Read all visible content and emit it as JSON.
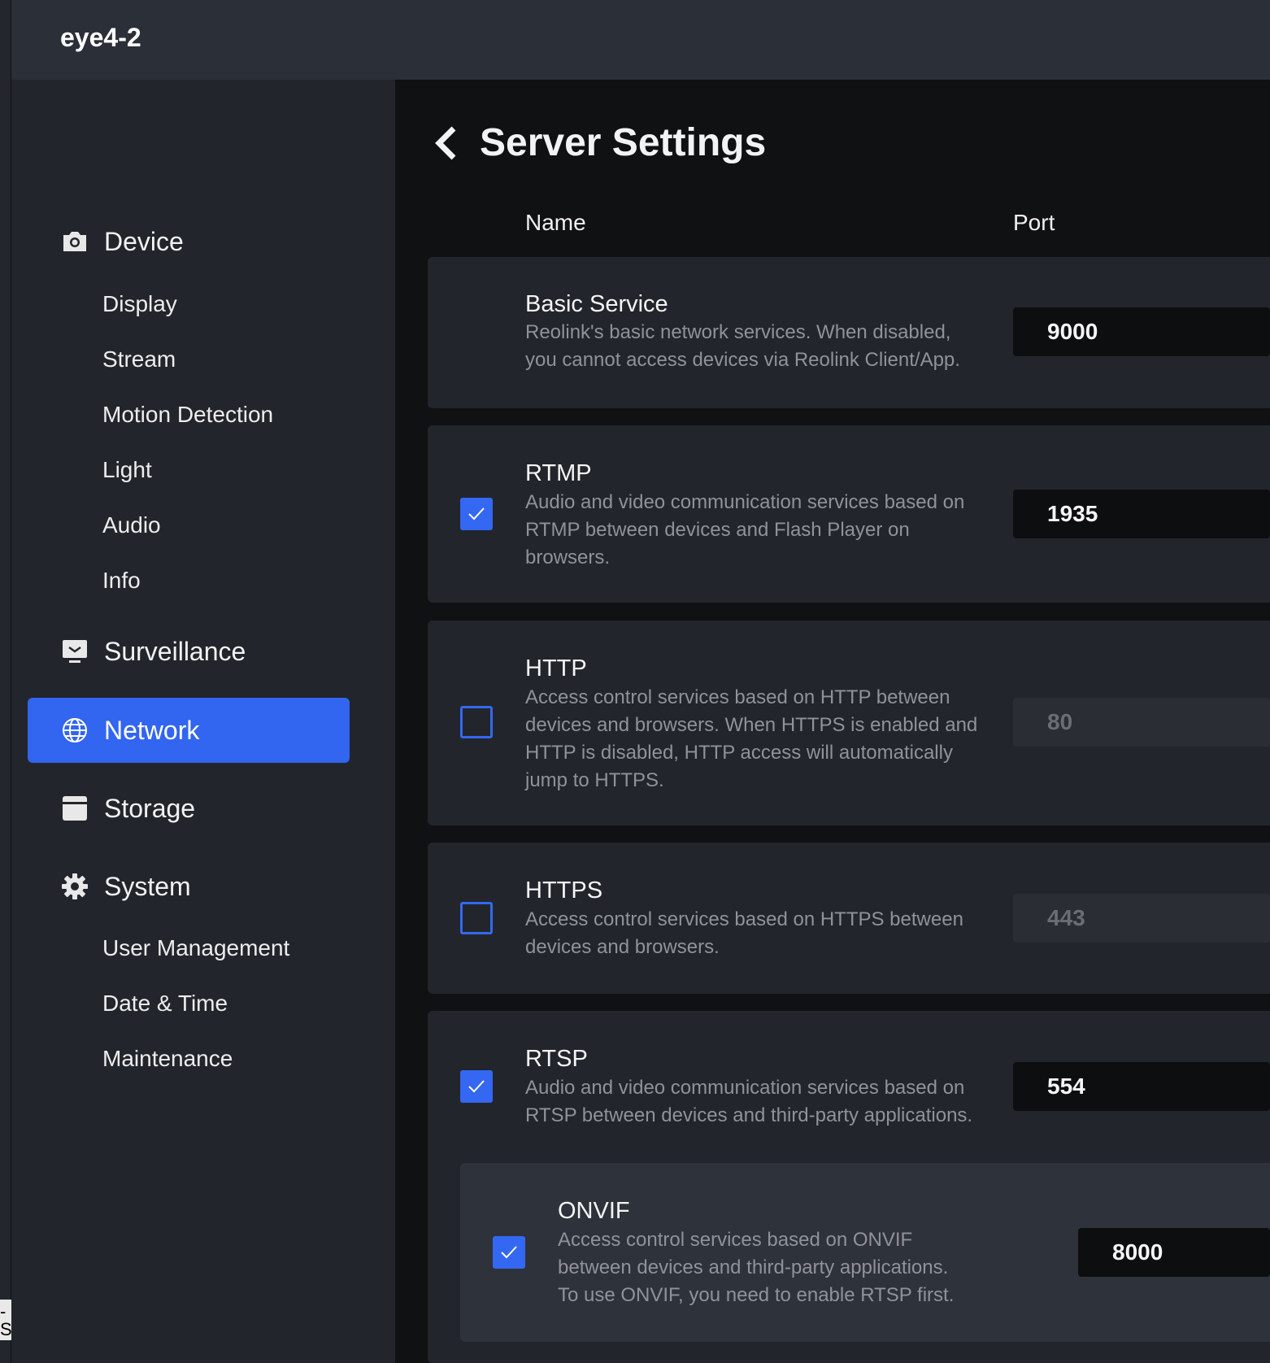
{
  "app_title": "eye4-2",
  "edge_text": "-S",
  "sidebar": {
    "sections": [
      {
        "label": "Device",
        "icon": "camera-icon"
      },
      {
        "label": "Surveillance",
        "icon": "monitor-icon"
      },
      {
        "label": "Network",
        "icon": "globe-icon"
      },
      {
        "label": "Storage",
        "icon": "storage-icon"
      },
      {
        "label": "System",
        "icon": "gear-icon"
      }
    ],
    "device_items": [
      "Display",
      "Stream",
      "Motion Detection",
      "Light",
      "Audio",
      "Info"
    ],
    "system_items": [
      "User Management",
      "Date & Time",
      "Maintenance"
    ],
    "active_section": "Network",
    "accent_color": "#3265f0"
  },
  "main": {
    "title": "Server Settings",
    "columns": {
      "name": "Name",
      "port": "Port"
    },
    "services": [
      {
        "name": "Basic Service",
        "desc": [
          "Reolink's basic network services. When disabled,",
          "you cannot access devices via Reolink Client/App."
        ],
        "port": "9000",
        "checkbox": null
      },
      {
        "name": "RTMP",
        "desc": [
          "Audio and video communication services based on",
          "RTMP between devices and Flash Player on",
          "browsers."
        ],
        "port": "1935",
        "checkbox": true
      },
      {
        "name": "HTTP",
        "desc": [
          "Access control services based on HTTP between",
          "devices and browsers. When HTTPS is enabled and",
          "HTTP is disabled, HTTP access will automatically",
          "jump to HTTPS."
        ],
        "port": "80",
        "checkbox": false
      },
      {
        "name": "HTTPS",
        "desc": [
          "Access control services based on HTTPS between",
          "devices and browsers."
        ],
        "port": "443",
        "checkbox": false
      },
      {
        "name": "RTSP",
        "desc": [
          "Audio and video communication services based on",
          "RTSP between devices and third-party applications."
        ],
        "port": "554",
        "checkbox": true
      },
      {
        "name": "ONVIF",
        "desc": [
          "Access control services based on ONVIF",
          "between devices and third-party applications.",
          "To use ONVIF, you need to enable RTSP first."
        ],
        "port": "8000",
        "checkbox": true
      }
    ]
  }
}
